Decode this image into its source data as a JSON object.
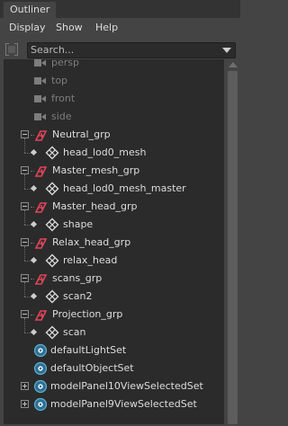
{
  "window": {
    "title": "Outliner"
  },
  "menu": {
    "items": [
      "Display",
      "Show",
      "Help"
    ]
  },
  "search": {
    "placeholder": "Search..."
  },
  "icons": {
    "camera": "camera-icon",
    "group": "group-transform-icon",
    "mesh": "mesh-shape-icon",
    "set": "object-set-icon",
    "grip": "filter-grip-icon"
  },
  "colors": {
    "panel": "#444444",
    "tree_bg": "#2b2b2b",
    "text": "#dddddd",
    "text_dim": "#7d7d7d",
    "group_icon": "#e0455a",
    "set_icon": "#5fb0d6"
  },
  "tree": [
    {
      "label": "persp",
      "icon": "camera",
      "dim": true,
      "depth": 0
    },
    {
      "label": "top",
      "icon": "camera",
      "dim": true,
      "depth": 0
    },
    {
      "label": "front",
      "icon": "camera",
      "dim": true,
      "depth": 0
    },
    {
      "label": "side",
      "icon": "camera",
      "dim": true,
      "depth": 0
    },
    {
      "label": "Neutral_grp",
      "icon": "group",
      "depth": 0,
      "expander": "minus"
    },
    {
      "label": "head_lod0_mesh",
      "icon": "mesh",
      "depth": 1
    },
    {
      "label": "Master_mesh_grp",
      "icon": "group",
      "depth": 0,
      "expander": "minus"
    },
    {
      "label": "head_lod0_mesh_master",
      "icon": "mesh",
      "depth": 1
    },
    {
      "label": "Master_head_grp",
      "icon": "group",
      "depth": 0,
      "expander": "minus"
    },
    {
      "label": "shape",
      "icon": "mesh",
      "depth": 1
    },
    {
      "label": "Relax_head_grp",
      "icon": "group",
      "depth": 0,
      "expander": "minus"
    },
    {
      "label": "relax_head",
      "icon": "mesh",
      "depth": 1
    },
    {
      "label": "scans_grp",
      "icon": "group",
      "depth": 0,
      "expander": "minus"
    },
    {
      "label": "scan2",
      "icon": "mesh",
      "depth": 1
    },
    {
      "label": "Projection_grp",
      "icon": "group",
      "depth": 0,
      "expander": "minus"
    },
    {
      "label": "scan",
      "icon": "mesh",
      "depth": 1
    },
    {
      "label": "defaultLightSet",
      "icon": "set",
      "depth": 0
    },
    {
      "label": "defaultObjectSet",
      "icon": "set",
      "depth": 0
    },
    {
      "label": "modelPanel10ViewSelectedSet",
      "icon": "set",
      "depth": 0,
      "expander": "plus"
    },
    {
      "label": "modelPanel9ViewSelectedSet",
      "icon": "set",
      "depth": 0,
      "expander": "plus"
    }
  ]
}
